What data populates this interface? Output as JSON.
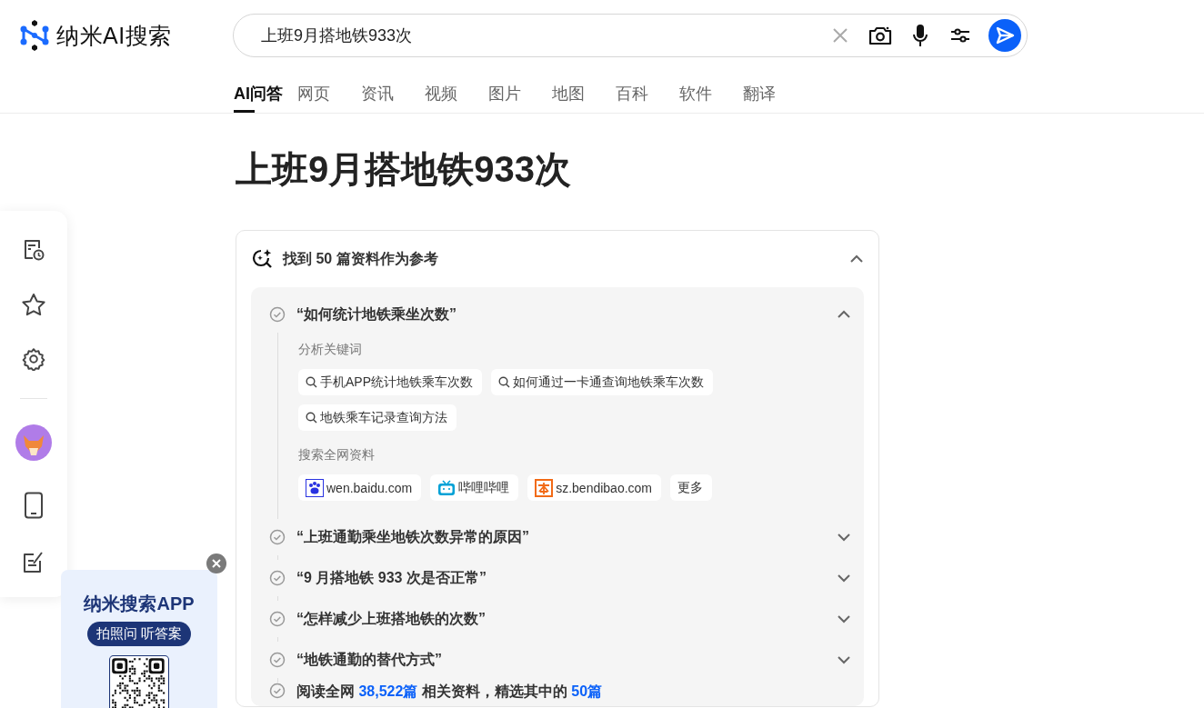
{
  "brand": {
    "name": "纳米AI搜索"
  },
  "search": {
    "value": "上班9月搭地铁933次"
  },
  "tabs": [
    {
      "label": "AI问答",
      "selected": true
    },
    {
      "label": "网页",
      "selected": false
    },
    {
      "label": "资讯",
      "selected": false
    },
    {
      "label": "视频",
      "selected": false
    },
    {
      "label": "图片",
      "selected": false
    },
    {
      "label": "地图",
      "selected": false
    },
    {
      "label": "百科",
      "selected": false
    },
    {
      "label": "软件",
      "selected": false
    },
    {
      "label": "翻译",
      "selected": false
    }
  ],
  "title": "上班9月搭地铁933次",
  "references": {
    "heading": "找到 50 篇资料作为参考",
    "expanded": true,
    "steps": [
      {
        "query": "“如何统计地铁乘坐次数”",
        "expanded": true,
        "keywords_label": "分析关键词",
        "keywords": [
          "手机APP统计地铁乘车次数",
          "如何通过一卡通查询地铁乘车次数",
          "地铁乘车记录查询方法"
        ],
        "sources_label": "搜索全网资料",
        "sources": [
          {
            "label": "wen.baidu.com",
            "kind": "paw"
          },
          {
            "label": "哔哩哔哩",
            "kind": "tv"
          },
          {
            "label": "sz.bendibao.com",
            "kind": "square"
          },
          {
            "label": "更多",
            "kind": "more"
          }
        ]
      },
      {
        "query": "“上班通勤乘坐地铁次数异常的原因”",
        "expanded": false
      },
      {
        "query": "“9 月搭地铁 933 次是否正常”",
        "expanded": false
      },
      {
        "query": "“怎样减少上班搭地铁的次数”",
        "expanded": false
      },
      {
        "query": "“地铁通勤的替代方式”",
        "expanded": false
      }
    ],
    "summary": [
      {
        "text": "阅读全网 ",
        "kind": "plain"
      },
      {
        "text": "38,522篇",
        "kind": "link"
      },
      {
        "text": " 相关资料，精选其中的 ",
        "kind": "plain"
      },
      {
        "text": "50篇",
        "kind": "link"
      }
    ]
  },
  "promo": {
    "title": "纳米搜索APP",
    "tagline": "拍照问 听答案"
  }
}
